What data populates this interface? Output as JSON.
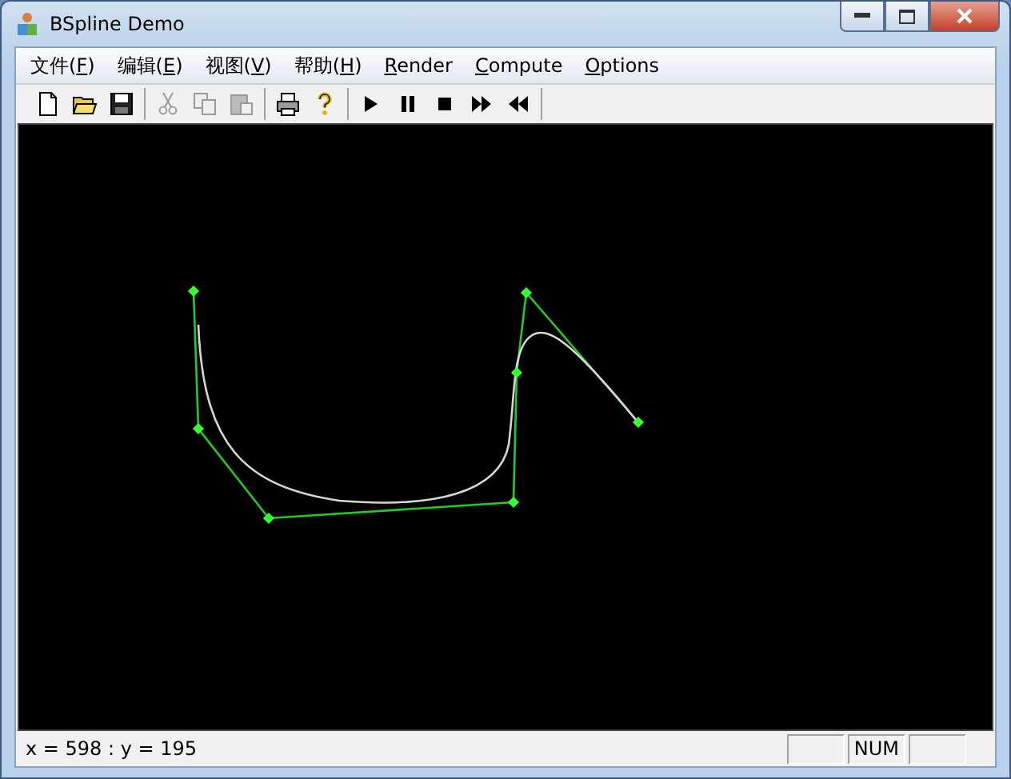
{
  "window": {
    "title": "BSpline Demo"
  },
  "menu": [
    {
      "before": "文件(",
      "access_key": "F",
      "after": ")"
    },
    {
      "before": "编辑(",
      "access_key": "E",
      "after": ")"
    },
    {
      "before": "视图(",
      "access_key": "V",
      "after": ")"
    },
    {
      "before": "帮助(",
      "access_key": "H",
      "after": ")"
    },
    {
      "access_key": "R",
      "after": "ender"
    },
    {
      "access_key": "C",
      "after": "ompute"
    },
    {
      "access_key": "O",
      "after": "ptions"
    }
  ],
  "toolbar": [
    [
      {
        "kind": "new",
        "disabled": false
      },
      {
        "kind": "open",
        "disabled": false
      },
      {
        "kind": "save",
        "disabled": false
      }
    ],
    [
      {
        "kind": "cut",
        "disabled": true
      },
      {
        "kind": "copy",
        "disabled": true
      },
      {
        "kind": "paste",
        "disabled": true
      }
    ],
    [
      {
        "kind": "print",
        "disabled": false
      },
      {
        "kind": "help",
        "disabled": false
      }
    ],
    [
      {
        "kind": "play",
        "disabled": false
      },
      {
        "kind": "pause",
        "disabled": false
      },
      {
        "kind": "stop",
        "disabled": false
      },
      {
        "kind": "forward",
        "disabled": false
      },
      {
        "kind": "rewind",
        "disabled": false
      }
    ]
  ],
  "status_bar": {
    "text": "x = 598 : y = 195",
    "indicators": [
      {
        "kind": "blank"
      },
      {
        "kind": "text",
        "text": "NUM"
      },
      {
        "kind": "blank"
      }
    ]
  }
}
